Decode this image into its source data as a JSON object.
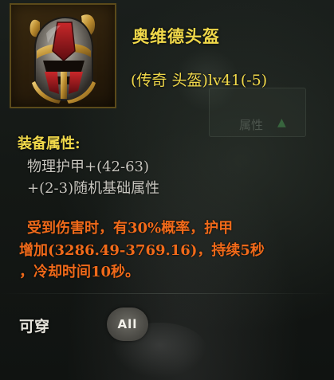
{
  "item": {
    "name": "奥维德头盔",
    "type_line": "(传奇 头盔)lv41(-5)",
    "icon": "helmet-icon"
  },
  "background": {
    "ghost_button_label": "属性"
  },
  "attributes": {
    "title": "装备属性:",
    "lines": [
      "物理护甲+(42-63)",
      "+(2-3)随机基础属性"
    ]
  },
  "effect": {
    "lines": [
      "受到伤害时，有30%概率，护甲",
      "增加(3286.49-3769.16)，持续5秒",
      "，冷却时间10秒。"
    ],
    "color": "#f06a1a"
  },
  "wearable": {
    "label": "可穿",
    "class": "All"
  },
  "colors": {
    "title": "#f0d84a",
    "text": "#c9c7c0",
    "effect": "#f06a1a",
    "background": "#141815"
  }
}
